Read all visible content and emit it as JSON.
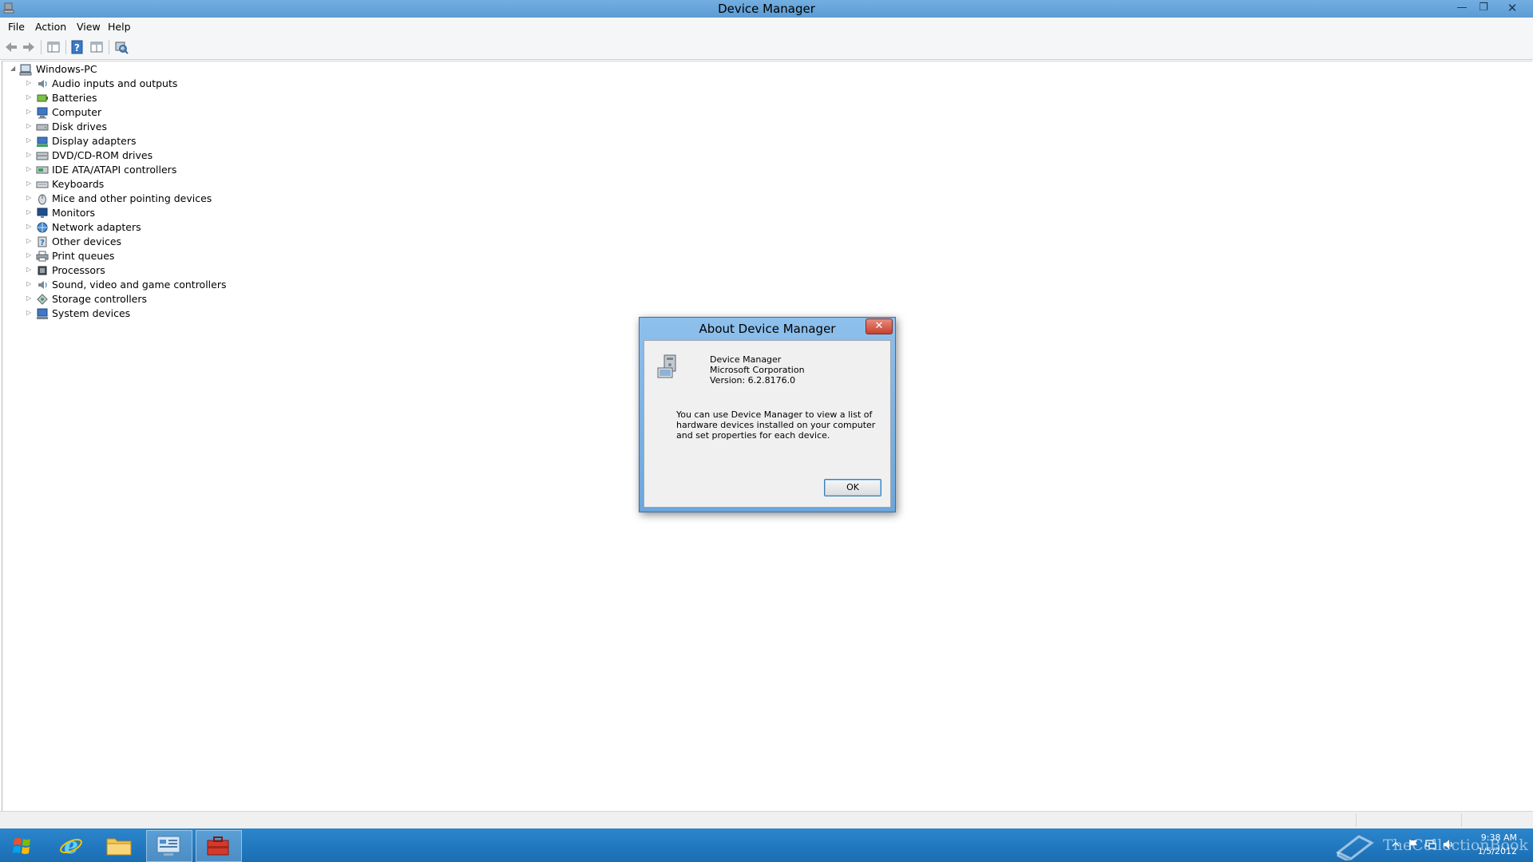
{
  "window": {
    "title": "Device Manager",
    "minimize_glyph": "—",
    "maximize_glyph": "❐",
    "close_glyph": "✕"
  },
  "menu": {
    "items": [
      "File",
      "Action",
      "View",
      "Help"
    ]
  },
  "toolbar": {
    "buttons": [
      "back-icon",
      "forward-icon",
      "show-hide-tree-icon",
      "help-icon",
      "properties-view-icon",
      "scan-hardware-icon"
    ]
  },
  "tree": {
    "root": "Windows-PC",
    "categories": [
      {
        "label": "Audio inputs and outputs",
        "icon": "speaker-icon"
      },
      {
        "label": "Batteries",
        "icon": "battery-icon"
      },
      {
        "label": "Computer",
        "icon": "computer-icon"
      },
      {
        "label": "Disk drives",
        "icon": "disk-drive-icon"
      },
      {
        "label": "Display adapters",
        "icon": "display-adapter-icon"
      },
      {
        "label": "DVD/CD-ROM drives",
        "icon": "dvd-drive-icon"
      },
      {
        "label": "IDE ATA/ATAPI controllers",
        "icon": "ide-controller-icon"
      },
      {
        "label": "Keyboards",
        "icon": "keyboard-icon"
      },
      {
        "label": "Mice and other pointing devices",
        "icon": "mouse-icon"
      },
      {
        "label": "Monitors",
        "icon": "monitor-icon"
      },
      {
        "label": "Network adapters",
        "icon": "network-adapter-icon"
      },
      {
        "label": "Other devices",
        "icon": "unknown-device-icon"
      },
      {
        "label": "Print queues",
        "icon": "printer-icon"
      },
      {
        "label": "Processors",
        "icon": "processor-icon"
      },
      {
        "label": "Sound, video and game controllers",
        "icon": "sound-icon"
      },
      {
        "label": "Storage controllers",
        "icon": "storage-controller-icon"
      },
      {
        "label": "System devices",
        "icon": "system-device-icon"
      }
    ]
  },
  "dialog": {
    "title": "About Device Manager",
    "close_glyph": "✕",
    "product": "Device Manager",
    "company": "Microsoft Corporation",
    "version": "Version: 6.2.8176.0",
    "description": "You can use Device Manager to view a list of hardware devices installed on your computer and set properties for each device.",
    "ok_label": "OK"
  },
  "taskbar": {
    "apps": [
      "internet-explorer-icon",
      "file-explorer-icon",
      "control-panel-icon",
      "device-manager-icon"
    ],
    "active_app": "device-manager-icon",
    "clock_time": "9:38 AM",
    "clock_date": "1/5/2012",
    "watermark": "TheCollectionBook"
  },
  "colors": {
    "title_bar": "#5b9bd4",
    "taskbar": "#1a6db3",
    "dialog_frame": "#6ba6dc",
    "close_button": "#c7412f"
  }
}
